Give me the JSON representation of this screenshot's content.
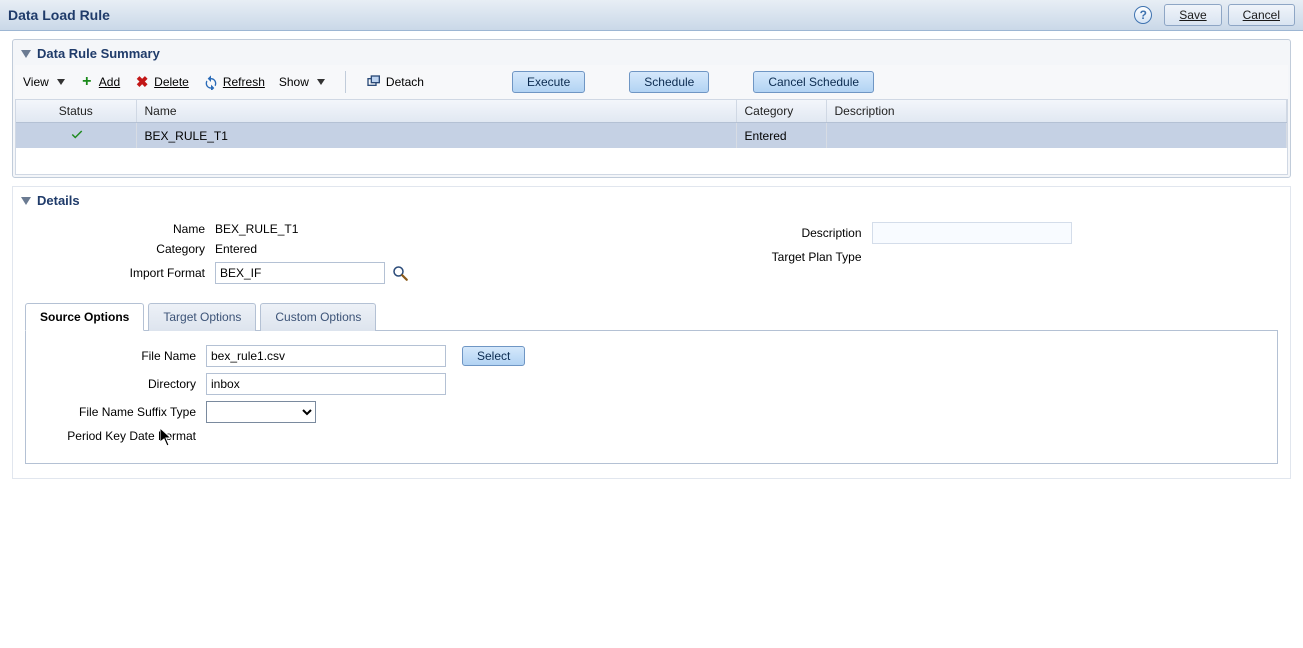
{
  "header": {
    "title": "Data Load Rule",
    "save": "Save",
    "cancel": "Cancel"
  },
  "summary": {
    "title": "Data Rule Summary",
    "menus": {
      "view": "View",
      "show": "Show"
    },
    "actions": {
      "add": "Add",
      "delete": "Delete",
      "refresh": "Refresh",
      "detach": "Detach",
      "execute": "Execute",
      "schedule": "Schedule",
      "cancel_schedule": "Cancel Schedule"
    },
    "columns": {
      "status": "Status",
      "name": "Name",
      "category": "Category",
      "description": "Description"
    },
    "rows": [
      {
        "status": "ok",
        "name": "BEX_RULE_T1",
        "category": "Entered",
        "description": ""
      }
    ]
  },
  "details": {
    "title": "Details",
    "labels": {
      "name": "Name",
      "category": "Category",
      "import_format": "Import Format",
      "description": "Description",
      "target_plan_type": "Target Plan Type"
    },
    "values": {
      "name": "BEX_RULE_T1",
      "category": "Entered",
      "import_format": "BEX_IF",
      "description": "",
      "target_plan_type": ""
    },
    "tabs": {
      "source": "Source Options",
      "target": "Target Options",
      "custom": "Custom Options"
    },
    "source_options": {
      "labels": {
        "file_name": "File Name",
        "directory": "Directory",
        "suffix_type": "File Name Suffix Type",
        "period_key_fmt": "Period Key Date Format",
        "select": "Select"
      },
      "values": {
        "file_name": "bex_rule1.csv",
        "directory": "inbox",
        "suffix_type": "",
        "period_key_fmt": ""
      }
    }
  }
}
